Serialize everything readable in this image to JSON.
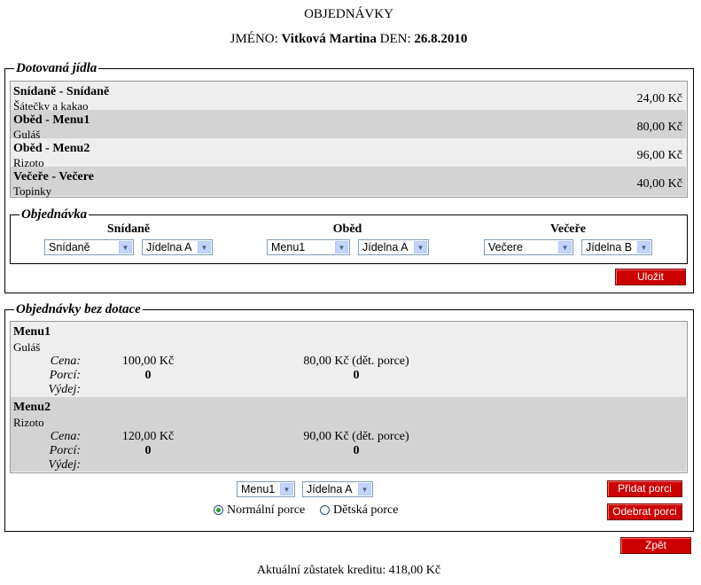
{
  "header": {
    "title": "OBJEDNÁVKY",
    "name_label": "JMÉNO:",
    "name_value": "Vitková Martina",
    "day_label": "DEN:",
    "day_value": "26.8.2010"
  },
  "subsidized": {
    "legend": "Dotovaná jídla",
    "meals": [
      {
        "name": "Snídaně - Snídaně",
        "desc": "Šátečky a kakao",
        "price": "24,00 Kč"
      },
      {
        "name": "Oběd - Menu1",
        "desc": "Guláš",
        "price": "80,00 Kč"
      },
      {
        "name": "Oběd - Menu2",
        "desc": "Rizoto",
        "price": "96,00 Kč"
      },
      {
        "name": "Večeře - Večere",
        "desc": "Topinky",
        "price": "40,00 Kč"
      }
    ],
    "order": {
      "legend": "Objednávka",
      "groups": [
        {
          "heading": "Snídaně",
          "meal_value": "Snídaně",
          "canteen_value": "Jídelna A"
        },
        {
          "heading": "Oběd",
          "meal_value": "Menu1",
          "canteen_value": "Jídelna A"
        },
        {
          "heading": "Večeře",
          "meal_value": "Večere",
          "canteen_value": "Jídelna B"
        }
      ]
    },
    "save_label": "Uložit"
  },
  "unsubsidized": {
    "legend": "Objednávky bez dotace",
    "labels": {
      "price": "Cena:",
      "portions": "Porcí:",
      "issue": "Výdej:"
    },
    "items": [
      {
        "name": "Menu1",
        "desc": "Guláš",
        "price": "100,00 Kč",
        "child_price": "80,00 Kč (dět. porce)",
        "portions": "0",
        "child_portions": "0"
      },
      {
        "name": "Menu2",
        "desc": "Rizoto",
        "price": "120,00 Kč",
        "child_price": "90,00 Kč (dět. porce)",
        "portions": "0",
        "child_portions": "0"
      }
    ],
    "menu_select": "Menu1",
    "canteen_select": "Jídelna A",
    "radio_normal": "Normální porce",
    "radio_child": "Dětská porce",
    "add_label": "Přidat porci",
    "remove_label": "Odebrat porci"
  },
  "back_label": "Zpět",
  "balance_text": "Aktuální zůstatek kreditu: 418,00 Kč"
}
